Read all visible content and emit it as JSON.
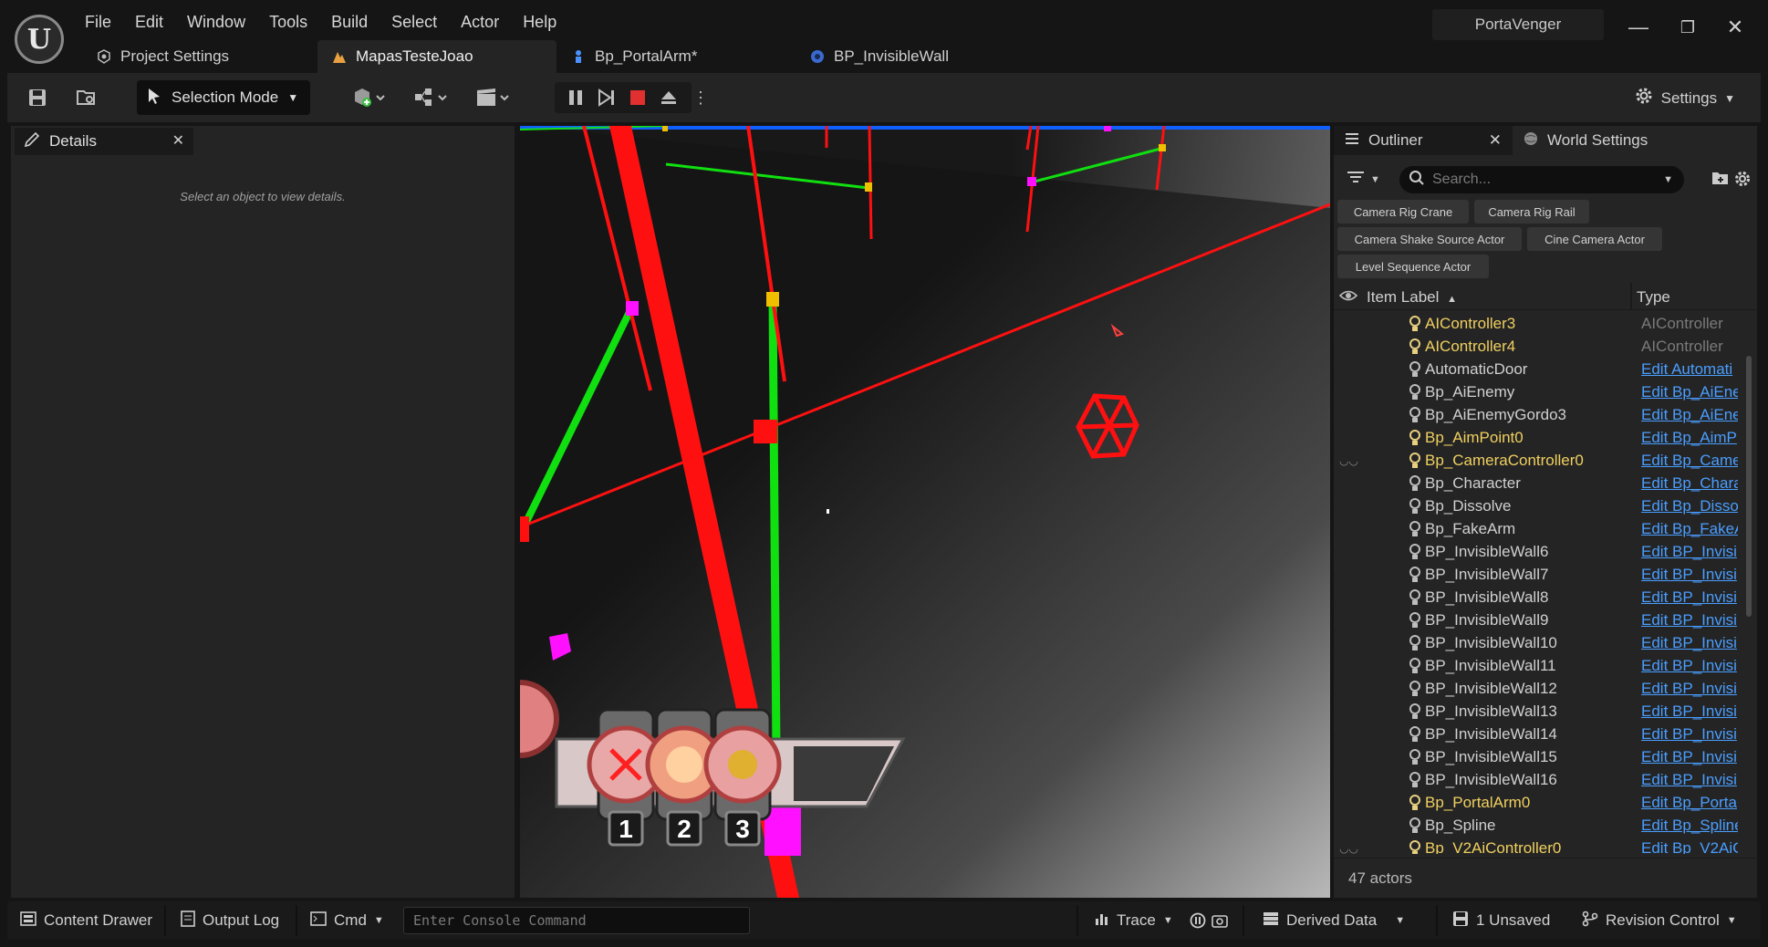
{
  "app": {
    "project_name": "PortaVenger",
    "menu": [
      "File",
      "Edit",
      "Window",
      "Tools",
      "Build",
      "Select",
      "Actor",
      "Help"
    ],
    "tabs": [
      {
        "label": "Project Settings",
        "active": false
      },
      {
        "label": "MapasTesteJoao",
        "active": true
      },
      {
        "label": "Bp_PortalArm*",
        "active": false
      },
      {
        "label": "BP_InvisibleWall",
        "active": false
      }
    ]
  },
  "toolbar": {
    "selection_mode": "Selection Mode",
    "settings_label": "Settings"
  },
  "details": {
    "tab_label": "Details",
    "hint": "Select an object to view details."
  },
  "viewport": {
    "hotbar_slots": [
      "1",
      "2",
      "3"
    ]
  },
  "outliner": {
    "tab_label": "Outliner",
    "world_settings_label": "World Settings",
    "search_placeholder": "Search...",
    "filter_chips": [
      "Camera Rig Crane",
      "Camera Rig Rail",
      "Camera Shake Source Actor",
      "Cine Camera Actor",
      "Level Sequence Actor"
    ],
    "col_label": "Item Label",
    "col_type": "Type",
    "rows": [
      {
        "label": "AIController3",
        "type": "AIController",
        "link": false,
        "highlight": true,
        "eye": false
      },
      {
        "label": "AIController4",
        "type": "AIController",
        "link": false,
        "highlight": true,
        "eye": false
      },
      {
        "label": "AutomaticDoor",
        "type": "Edit Automati",
        "link": true,
        "highlight": false,
        "eye": false
      },
      {
        "label": "Bp_AiEnemy",
        "type": "Edit Bp_AiEne",
        "link": true,
        "highlight": false,
        "eye": false
      },
      {
        "label": "Bp_AiEnemyGordo3",
        "type": "Edit Bp_AiEne",
        "link": true,
        "highlight": false,
        "eye": false
      },
      {
        "label": "Bp_AimPoint0",
        "type": "Edit Bp_AimP",
        "link": true,
        "highlight": true,
        "eye": false
      },
      {
        "label": "Bp_CameraController0",
        "type": "Edit Bp_Came",
        "link": true,
        "highlight": true,
        "eye": true
      },
      {
        "label": "Bp_Character",
        "type": "Edit Bp_Chara",
        "link": true,
        "highlight": false,
        "eye": false
      },
      {
        "label": "Bp_Dissolve",
        "type": "Edit Bp_Disso",
        "link": true,
        "highlight": false,
        "eye": false
      },
      {
        "label": "Bp_FakeArm",
        "type": "Edit Bp_FakeA",
        "link": true,
        "highlight": false,
        "eye": false
      },
      {
        "label": "BP_InvisibleWall6",
        "type": "Edit BP_Invisi",
        "link": true,
        "highlight": false,
        "eye": false
      },
      {
        "label": "BP_InvisibleWall7",
        "type": "Edit BP_Invisi",
        "link": true,
        "highlight": false,
        "eye": false
      },
      {
        "label": "BP_InvisibleWall8",
        "type": "Edit BP_Invisi",
        "link": true,
        "highlight": false,
        "eye": false
      },
      {
        "label": "BP_InvisibleWall9",
        "type": "Edit BP_Invisi",
        "link": true,
        "highlight": false,
        "eye": false
      },
      {
        "label": "BP_InvisibleWall10",
        "type": "Edit BP_Invisi",
        "link": true,
        "highlight": false,
        "eye": false
      },
      {
        "label": "BP_InvisibleWall11",
        "type": "Edit BP_Invisi",
        "link": true,
        "highlight": false,
        "eye": false
      },
      {
        "label": "BP_InvisibleWall12",
        "type": "Edit BP_Invisi",
        "link": true,
        "highlight": false,
        "eye": false
      },
      {
        "label": "BP_InvisibleWall13",
        "type": "Edit BP_Invisi",
        "link": true,
        "highlight": false,
        "eye": false
      },
      {
        "label": "BP_InvisibleWall14",
        "type": "Edit BP_Invisi",
        "link": true,
        "highlight": false,
        "eye": false
      },
      {
        "label": "BP_InvisibleWall15",
        "type": "Edit BP_Invisi",
        "link": true,
        "highlight": false,
        "eye": false
      },
      {
        "label": "BP_InvisibleWall16",
        "type": "Edit BP_Invisi",
        "link": true,
        "highlight": false,
        "eye": false
      },
      {
        "label": "Bp_PortalArm0",
        "type": "Edit Bp_Porta",
        "link": true,
        "highlight": true,
        "eye": false
      },
      {
        "label": "Bp_Spline",
        "type": "Edit Bp_Spline",
        "link": true,
        "highlight": false,
        "eye": false
      },
      {
        "label": "Bp_V2AiController0",
        "type": "Edit Bp_V2AiC",
        "link": true,
        "highlight": true,
        "eye": true
      }
    ],
    "actor_count": "47 actors"
  },
  "statusbar": {
    "content_drawer": "Content Drawer",
    "output_log": "Output Log",
    "cmd": "Cmd",
    "console_placeholder": "Enter Console Command",
    "trace": "Trace",
    "derived_data": "Derived Data",
    "unsaved": "1 Unsaved",
    "revision_control": "Revision Control"
  },
  "colors": {
    "highlight_label": "#f0d060",
    "plain_label": "#d0d0d0",
    "link": "#4a9eff",
    "debug_red": "#ff1010",
    "debug_green": "#10e010",
    "debug_magenta": "#ff10ff"
  }
}
